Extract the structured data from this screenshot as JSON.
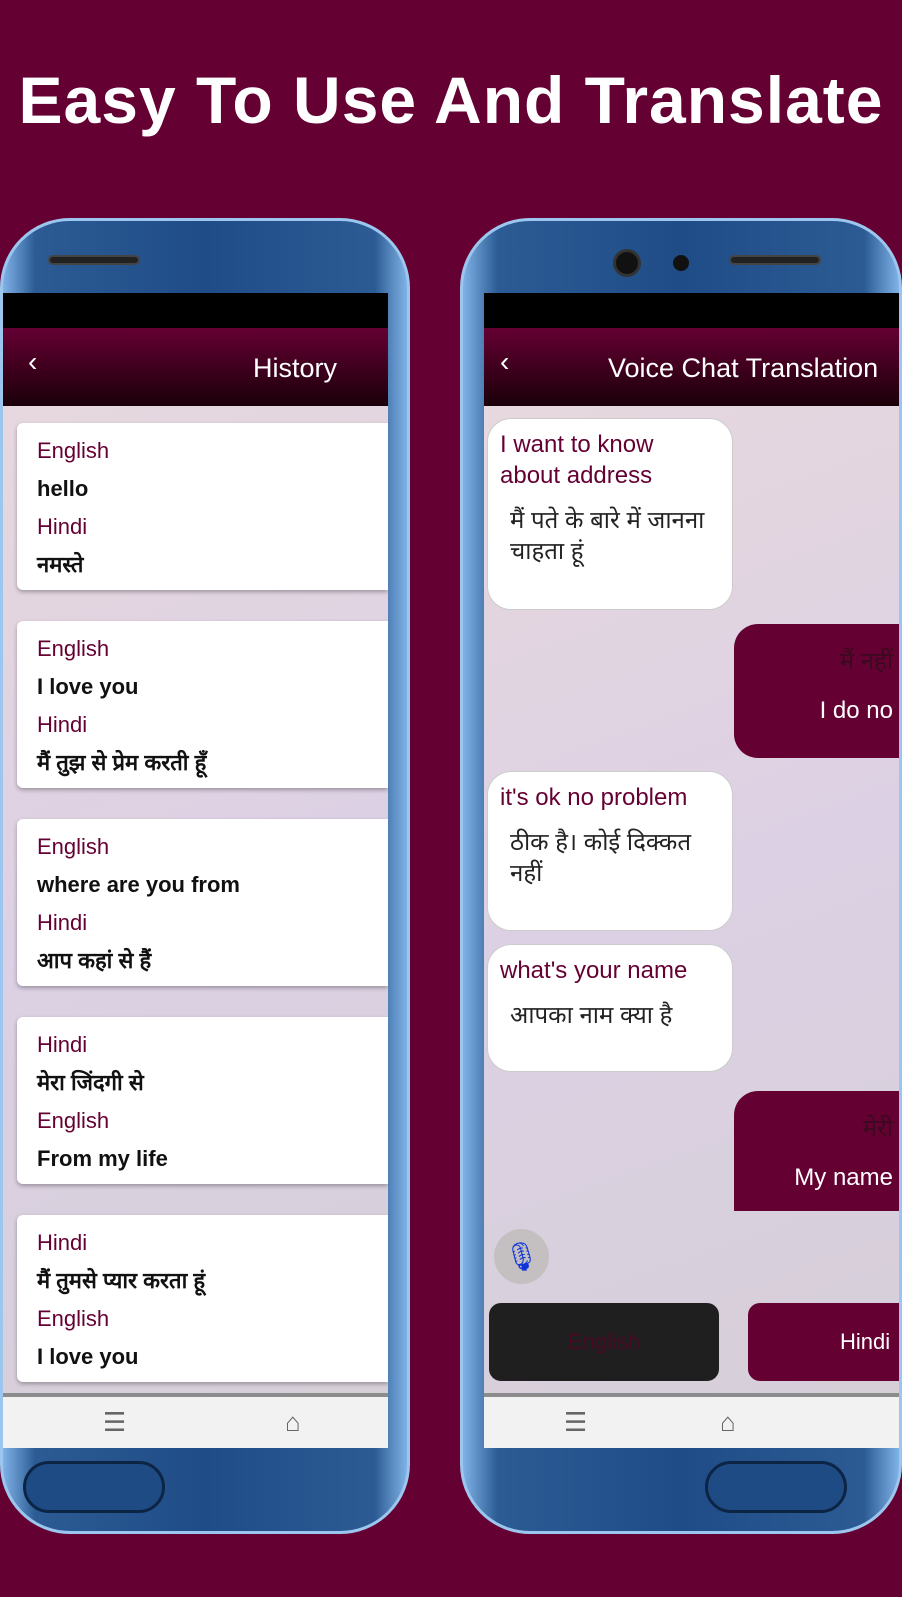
{
  "headline": "Easy To Use And Translate",
  "history": {
    "title": "History",
    "back_icon": "chevron-left-icon",
    "cards": [
      {
        "l1": "English",
        "v1": "hello",
        "l2": "Hindi",
        "v2": "नमस्ते"
      },
      {
        "l1": "English",
        "v1": "I love you",
        "l2": "Hindi",
        "v2": "मैं तुझ से प्रेम करती हूँ"
      },
      {
        "l1": "English",
        "v1": "where are you from",
        "l2": "Hindi",
        "v2": "आप कहां से हैं"
      },
      {
        "l1": "Hindi",
        "v1": "मेरा जिंदगी से",
        "l2": "English",
        "v2": "From my life"
      },
      {
        "l1": "Hindi",
        "v1": "मैं तुमसे प्यार करता हूं",
        "l2": "English",
        "v2": "I love you"
      }
    ]
  },
  "chat": {
    "title": "Voice Chat Translation",
    "left": [
      {
        "src": "I want to know about address",
        "tr": "मैं पते के बारे में जानना चाहता हूं"
      },
      {
        "src": "it's ok no problem",
        "tr": "ठीक है। कोई दिक्कत नहीं"
      },
      {
        "src": "what's your name",
        "tr": "आपका नाम क्या है"
      }
    ],
    "right": [
      {
        "hi": "मैं नहीं",
        "en": "I do no"
      },
      {
        "hi": "मेरी",
        "en": "My name"
      }
    ],
    "btn_english": "English",
    "btn_hindi": "Hindi"
  },
  "nav": {
    "menu": "☰",
    "home": "⌂"
  },
  "colors": {
    "brand": "#650033",
    "mic": "#1034d8",
    "frame": "#1f4c86"
  }
}
